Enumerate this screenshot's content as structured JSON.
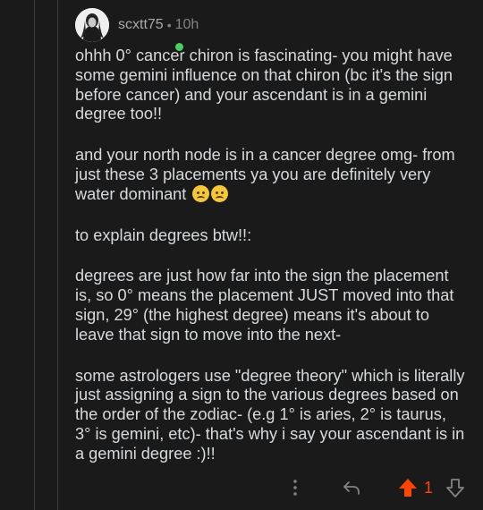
{
  "comment": {
    "username": "scxtt75",
    "separator": "•",
    "time": "10h",
    "paragraphs": [
      "ohhh 0° cancer chiron is fascinating- you might have some gemini influence on that chiron (bc it's the sign before cancer) and your ascendant is in a gemini degree too!!",
      "and your north node is in a cancer degree omg- from just these 3 placements ya you are definitely very water dominant",
      "to explain degrees btw!!:",
      "degrees are just how far into the sign the placement is, so 0° means the placement JUST moved into that sign, 29° (the highest degree) means it's about to leave that sign to move into the next-",
      "some astrologers use \"degree theory\" which is literally just assigning a sign to the various degrees based on the order of the zodiac- (e.g 1° is aries, 2° is taurus, 3° is gemini, etc)- that's why i say your ascendant is in a gemini degree :)!!"
    ],
    "emojis": [
      "worried-face",
      "worried-face"
    ],
    "status": "online"
  },
  "actions": {
    "score": "1",
    "upvote_state": "upvoted",
    "icons": [
      "more-options-icon",
      "reply-icon",
      "upvote-arrow-icon",
      "downvote-arrow-icon"
    ]
  },
  "colors": {
    "background": "#1a1a1b",
    "text": "#d7dadc",
    "upvote": "#ff4500",
    "online": "#46d160"
  }
}
